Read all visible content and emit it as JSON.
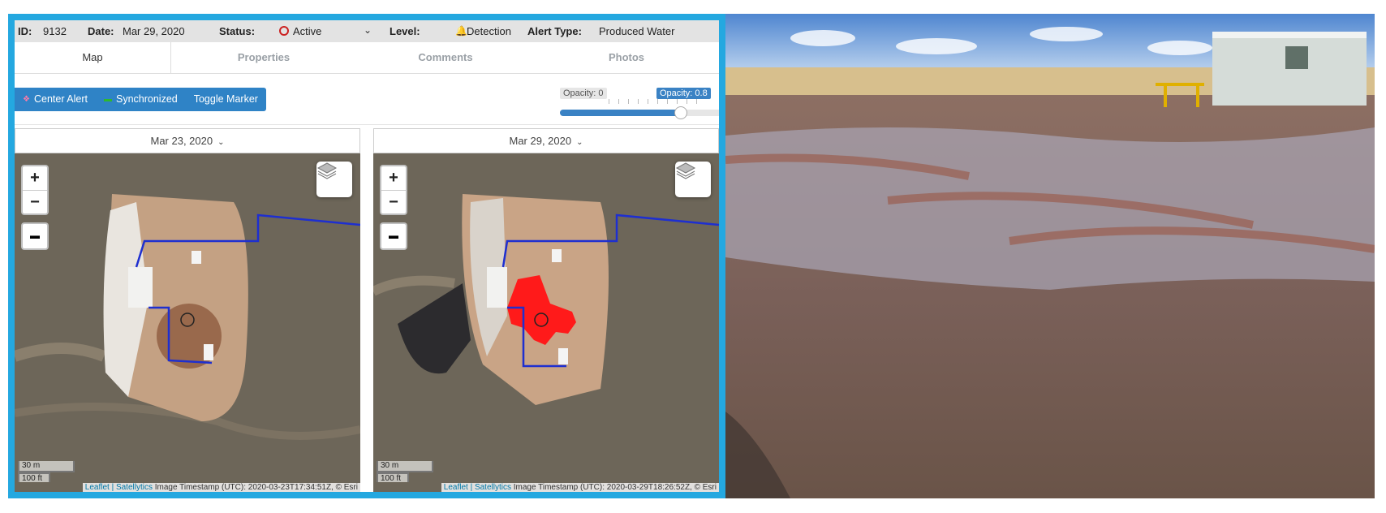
{
  "header": {
    "id_label": "ID:",
    "id_value": "9132",
    "date_label": "Date:",
    "date_value": "Mar 29, 2020",
    "status_label": "Status:",
    "status_value": "Active",
    "level_label": "Level:",
    "level_value": "Detection",
    "alert_type_label": "Alert Type:",
    "alert_type_value": "Produced Water"
  },
  "tabs": [
    "Map",
    "Properties",
    "Comments",
    "Photos"
  ],
  "toolbar": {
    "center_alert": "Center Alert",
    "synchronized": "Synchronized",
    "toggle_marker": "Toggle Marker"
  },
  "opacity": {
    "min_label": "Opacity: 0",
    "value_label": "Opacity: 0.8",
    "value": 0.8
  },
  "maps": [
    {
      "date": "Mar 23, 2020",
      "scale_metric": "30 m",
      "scale_imperial": "100 ft",
      "attribution_links": "Leaflet | Satellytics",
      "attribution_text": " Image Timestamp (UTC): 2020-03-23T17:34:51Z, © Esri"
    },
    {
      "date": "Mar 29, 2020",
      "scale_metric": "30 m",
      "scale_imperial": "100 ft",
      "attribution_links": "Leaflet | Satellytics",
      "attribution_text": " Image Timestamp (UTC): 2020-03-29T18:26:52Z, © Esri"
    }
  ],
  "icons": {
    "status": "circle-outline-icon",
    "level": "bell-icon",
    "center": "crosshair-icon",
    "sync": "link-icon",
    "layers": "layers-icon",
    "measure": "ruler-icon"
  },
  "colors": {
    "accent": "#24a8e0",
    "button": "#2f83c6",
    "alert_red": "#ff1a1a",
    "pipeline": "#1e2fd0"
  }
}
